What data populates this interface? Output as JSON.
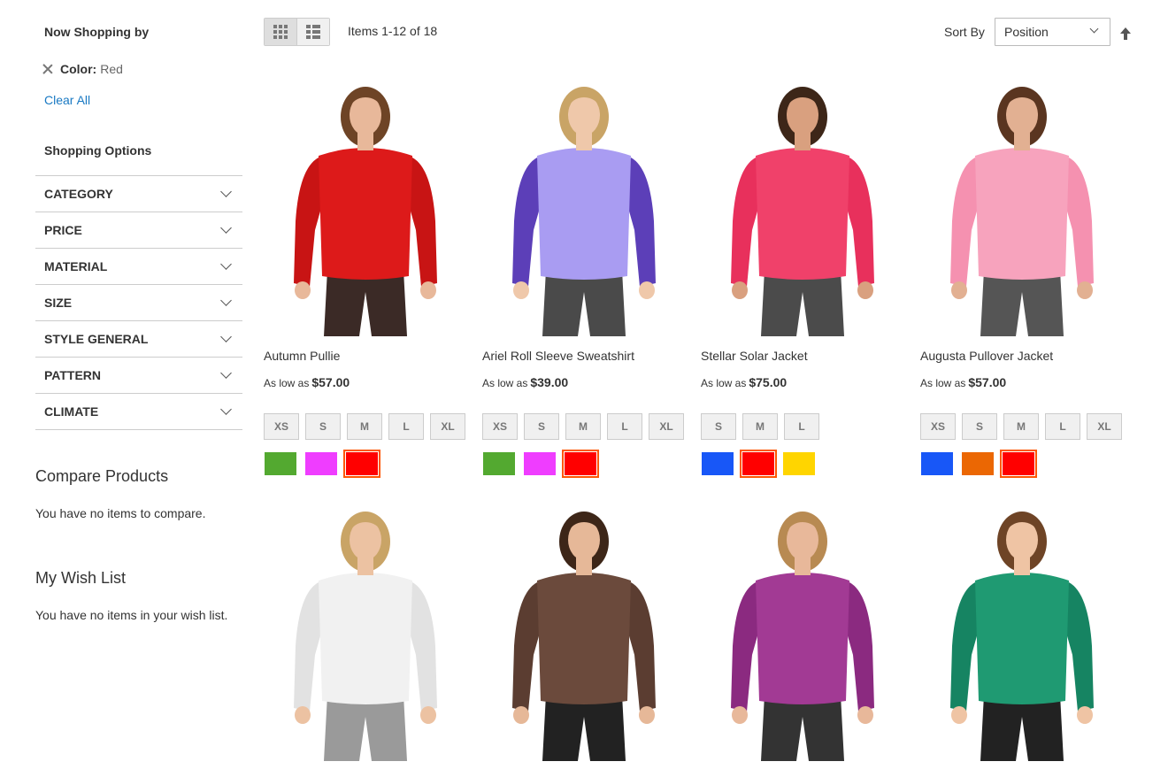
{
  "sidebar": {
    "now_shopping_title": "Now Shopping by",
    "active_filter": {
      "label": "Color:",
      "value": "Red"
    },
    "clear_all": "Clear All",
    "shopping_options_title": "Shopping Options",
    "facets": [
      "CATEGORY",
      "PRICE",
      "MATERIAL",
      "SIZE",
      "STYLE GENERAL",
      "PATTERN",
      "CLIMATE"
    ],
    "compare": {
      "title": "Compare Products",
      "empty": "You have no items to compare."
    },
    "wishlist": {
      "title": "My Wish List",
      "empty": "You have no items in your wish list."
    }
  },
  "toolbar": {
    "amount": "Items 1-12 of 18",
    "sort_label": "Sort By",
    "sort_value": "Position",
    "view_modes": [
      "grid",
      "list"
    ],
    "active_mode": "grid"
  },
  "products": [
    {
      "name": "Autumn Pullie",
      "price_prefix": "As low as",
      "price": "$57.00",
      "sizes": [
        "XS",
        "S",
        "M",
        "L",
        "XL"
      ],
      "swatches": [
        {
          "color": "#53a930",
          "selected": false
        },
        {
          "color": "#ef3dff",
          "selected": false
        },
        {
          "color": "#ff0000",
          "selected": true
        }
      ],
      "image": {
        "top": "#dd1a1a",
        "sleeve": "#c81414",
        "bottoms": "#3b2a26",
        "skin": "#e8b89a",
        "hair": "#6e4426"
      }
    },
    {
      "name": "Ariel Roll Sleeve Sweatshirt",
      "price_prefix": "As low as",
      "price": "$39.00",
      "sizes": [
        "XS",
        "S",
        "M",
        "L",
        "XL"
      ],
      "swatches": [
        {
          "color": "#53a930",
          "selected": false
        },
        {
          "color": "#ef3dff",
          "selected": false
        },
        {
          "color": "#ff0000",
          "selected": true
        }
      ],
      "image": {
        "top": "#a99cf2",
        "sleeve": "#5c3fb8",
        "bottoms": "#4a4a4a",
        "skin": "#efc8aa",
        "hair": "#c9a466"
      }
    },
    {
      "name": "Stellar Solar Jacket",
      "price_prefix": "As low as",
      "price": "$75.00",
      "sizes": [
        "S",
        "M",
        "L"
      ],
      "swatches": [
        {
          "color": "#1857f7",
          "selected": false
        },
        {
          "color": "#ff0000",
          "selected": true
        },
        {
          "color": "#ffd500",
          "selected": false
        }
      ],
      "image": {
        "top": "#f0416a",
        "sleeve": "#e8305c",
        "bottoms": "#4b4b4b",
        "skin": "#d9a07f",
        "hair": "#3d2618"
      }
    },
    {
      "name": "Augusta Pullover Jacket",
      "price_prefix": "As low as",
      "price": "$57.00",
      "sizes": [
        "XS",
        "S",
        "M",
        "L",
        "XL"
      ],
      "swatches": [
        {
          "color": "#1857f7",
          "selected": false
        },
        {
          "color": "#eb6703",
          "selected": false
        },
        {
          "color": "#ff0000",
          "selected": true
        }
      ],
      "image": {
        "top": "#f7a3bd",
        "sleeve": "#f591b0",
        "bottoms": "#555555",
        "skin": "#e2b092",
        "hair": "#5a3520"
      }
    },
    {
      "name": "",
      "image": {
        "top": "#f1f1f1",
        "sleeve": "#e2e2e2",
        "bottoms": "#9a9a9a",
        "skin": "#ecc2a2",
        "hair": "#c9a466"
      }
    },
    {
      "name": "",
      "image": {
        "top": "#6b4a3c",
        "sleeve": "#5b3d31",
        "bottoms": "#222222",
        "skin": "#e6b898",
        "hair": "#3d2618"
      }
    },
    {
      "name": "",
      "image": {
        "top": "#a23a94",
        "sleeve": "#8b2a80",
        "bottoms": "#333333",
        "skin": "#e8b89a",
        "hair": "#b88a52"
      }
    },
    {
      "name": "",
      "image": {
        "top": "#1f9a72",
        "sleeve": "#168462",
        "bottoms": "#222222",
        "skin": "#efc4a4",
        "hair": "#6e4426"
      }
    }
  ]
}
